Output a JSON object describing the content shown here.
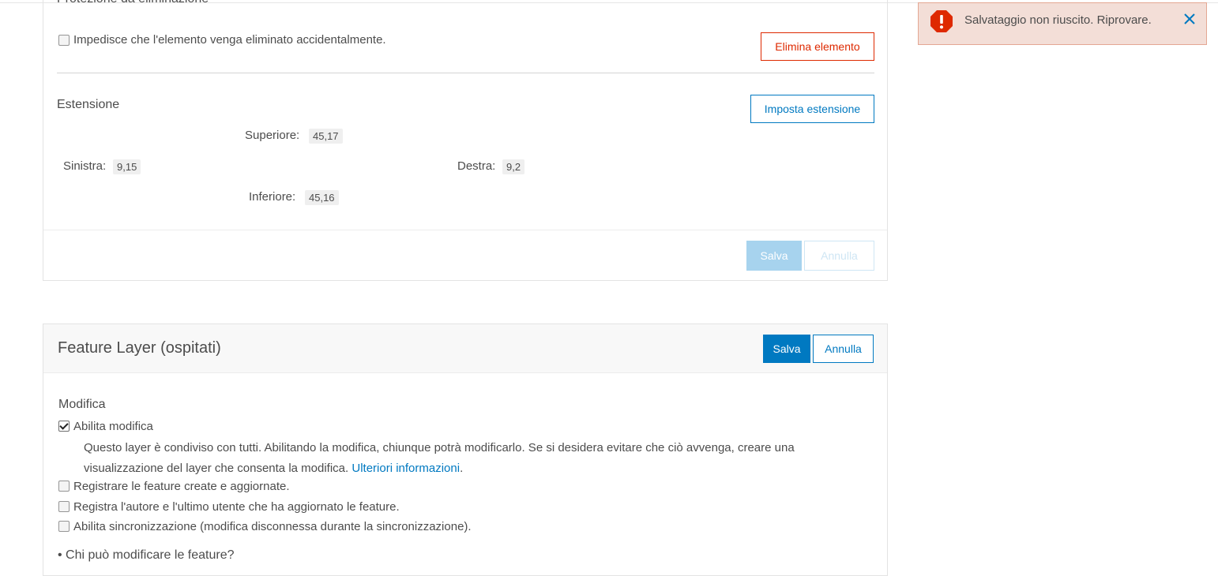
{
  "delete_protection": {
    "title": "Protezione da eliminazione",
    "checkbox_label": "Impedisce che l'elemento venga eliminato accidentalmente.",
    "checked": false,
    "delete_button": "Elimina elemento"
  },
  "extent": {
    "title": "Estensione",
    "set_button": "Imposta estensione",
    "top_label": "Superiore:",
    "top_value": "45,17",
    "left_label": "Sinistra:",
    "left_value": "9,15",
    "right_label": "Destra:",
    "right_value": "9,2",
    "bottom_label": "Inferiore:",
    "bottom_value": "45,16"
  },
  "card1_footer": {
    "save_label": "Salva",
    "cancel_label": "Annulla",
    "disabled": true
  },
  "feature_layer": {
    "title": "Feature Layer (ospitati)",
    "save_label": "Salva",
    "cancel_label": "Annulla",
    "editing_title": "Modifica",
    "enable_editing_label": "Abilita modifica",
    "enable_editing_checked": true,
    "description_line1": "Questo layer è condiviso con tutti. Abilitando la modifica, chiunque potrà modificarlo. Se si desidera evitare che ciò avvenga, creare una",
    "description_line2": "visualizzazione del layer che consenta la modifica.",
    "more_info_link": "Ulteriori informazioni",
    "description_end": ".",
    "options": [
      {
        "label": "Registrare le feature create e aggiornate.",
        "checked": false
      },
      {
        "label": "Registra l'autore e l'ultimo utente che ha aggiornato le feature.",
        "checked": false
      },
      {
        "label": "Abilita sincronizzazione (modifica disconnessa durante la sincronizzazione).",
        "checked": false
      }
    ],
    "who_can_edit": "• Chi può modificare le feature?"
  },
  "toast": {
    "message": "Salvataggio non riuscito. Riprovare.",
    "icon": "error-exclamation-icon",
    "close_icon": "close-icon",
    "color": "#de2900"
  },
  "colors": {
    "accent": "#0079c1",
    "danger": "#de2900"
  }
}
